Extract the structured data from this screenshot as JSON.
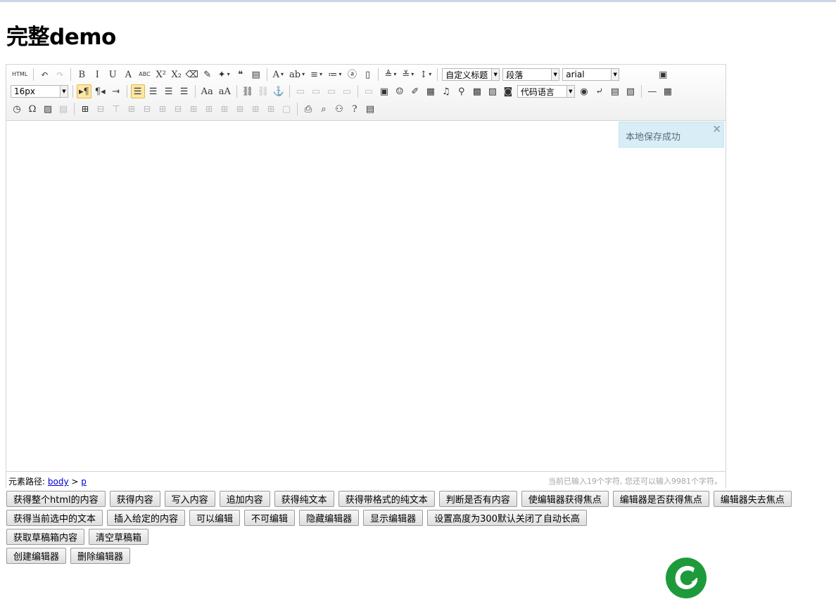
{
  "page": {
    "title": "完整demo"
  },
  "colors": {
    "toast_bg": "#d9edf7",
    "logo_green": "#1e9a3a",
    "footer_count": "#a6a6a6"
  },
  "toolbar": {
    "row1": [
      {
        "name": "source-html-icon",
        "glyph": "HTML",
        "state": "normal",
        "wide": true
      },
      {
        "name": "sep"
      },
      {
        "name": "undo-icon",
        "glyph": "↶",
        "state": "normal"
      },
      {
        "name": "redo-icon",
        "glyph": "↷",
        "state": "disabled"
      },
      {
        "name": "sep"
      },
      {
        "name": "bold-icon",
        "glyph": "B",
        "state": "normal"
      },
      {
        "name": "italic-icon",
        "glyph": "I",
        "state": "normal"
      },
      {
        "name": "underline-icon",
        "glyph": "U",
        "state": "normal"
      },
      {
        "name": "font-border-icon",
        "glyph": "A",
        "state": "normal"
      },
      {
        "name": "strikethrough-icon",
        "glyph": "ABC",
        "state": "normal",
        "wide": true
      },
      {
        "name": "superscript-icon",
        "glyph": "X²",
        "state": "normal"
      },
      {
        "name": "subscript-icon",
        "glyph": "X₂",
        "state": "normal"
      },
      {
        "name": "eraser-icon",
        "glyph": "⌫",
        "state": "normal"
      },
      {
        "name": "format-brush-icon",
        "glyph": "✎",
        "state": "normal"
      },
      {
        "name": "auto-typeset-icon",
        "glyph": "✦",
        "state": "normal",
        "caret": true
      },
      {
        "name": "blockquote-icon",
        "glyph": "❝",
        "state": "normal"
      },
      {
        "name": "paste-plain-icon",
        "glyph": "▤",
        "state": "normal"
      },
      {
        "name": "sep"
      },
      {
        "name": "font-color-icon",
        "glyph": "A",
        "state": "normal",
        "caret": true
      },
      {
        "name": "background-color-icon",
        "glyph": "ab",
        "state": "normal",
        "caret": true
      },
      {
        "name": "ordered-list-icon",
        "glyph": "≡",
        "state": "normal",
        "caret": true
      },
      {
        "name": "unordered-list-icon",
        "glyph": "≔",
        "state": "normal",
        "caret": true
      },
      {
        "name": "select-all-icon",
        "glyph": "ⓐ",
        "state": "normal"
      },
      {
        "name": "clear-doc-icon",
        "glyph": "▯",
        "state": "normal"
      },
      {
        "name": "sep"
      },
      {
        "name": "row-spacing-top-icon",
        "glyph": "≜",
        "state": "normal",
        "caret": true
      },
      {
        "name": "row-spacing-bottom-icon",
        "glyph": "≚",
        "state": "normal",
        "caret": true
      },
      {
        "name": "line-height-icon",
        "glyph": "↕",
        "state": "normal",
        "caret": true
      }
    ],
    "combos": [
      {
        "name": "custom-title-select",
        "value": "自定义标题",
        "width": 82
      },
      {
        "name": "paragraph-select",
        "value": "段落",
        "width": 81
      },
      {
        "name": "font-family-select",
        "value": "arial",
        "width": 81
      }
    ],
    "fullscreen_icon": "▣",
    "fontsize_combo": {
      "name": "font-size-select",
      "value": "16px",
      "width": 82
    },
    "row2": [
      {
        "name": "direction-ltr-icon",
        "glyph": "▸¶",
        "state": "active",
        "wide": true
      },
      {
        "name": "direction-rtl-icon",
        "glyph": "¶◂",
        "state": "normal",
        "wide": true
      },
      {
        "name": "indent-icon",
        "glyph": "⇥",
        "state": "normal"
      },
      {
        "name": "sep"
      },
      {
        "name": "align-left-icon",
        "glyph": "☰",
        "state": "active"
      },
      {
        "name": "align-center-icon",
        "glyph": "☰",
        "state": "normal"
      },
      {
        "name": "align-right-icon",
        "glyph": "☰",
        "state": "normal"
      },
      {
        "name": "align-justify-icon",
        "glyph": "☰",
        "state": "normal"
      },
      {
        "name": "sep"
      },
      {
        "name": "to-uppercase-icon",
        "glyph": "Aa",
        "state": "normal",
        "wide": true
      },
      {
        "name": "to-lowercase-icon",
        "glyph": "aA",
        "state": "normal",
        "wide": true
      },
      {
        "name": "sep"
      },
      {
        "name": "link-icon",
        "glyph": "⛓",
        "state": "normal"
      },
      {
        "name": "unlink-icon",
        "glyph": "⛓",
        "state": "disabled"
      },
      {
        "name": "anchor-icon",
        "glyph": "⚓",
        "state": "normal"
      },
      {
        "name": "sep"
      },
      {
        "name": "image-none-icon",
        "glyph": "▭",
        "state": "disabled"
      },
      {
        "name": "image-left-icon",
        "glyph": "▭",
        "state": "disabled"
      },
      {
        "name": "image-right-icon",
        "glyph": "▭",
        "state": "disabled"
      },
      {
        "name": "image-center-icon",
        "glyph": "▭",
        "state": "disabled"
      },
      {
        "name": "sep"
      },
      {
        "name": "simple-upload-icon",
        "glyph": "▭",
        "state": "disabled"
      },
      {
        "name": "insert-image-icon",
        "glyph": "▣",
        "state": "normal"
      },
      {
        "name": "emotion-icon",
        "glyph": "☺",
        "state": "normal"
      },
      {
        "name": "scrawl-icon",
        "glyph": "✐",
        "state": "normal"
      },
      {
        "name": "insert-video-icon",
        "glyph": "▦",
        "state": "normal"
      },
      {
        "name": "music-icon",
        "glyph": "♫",
        "state": "normal"
      },
      {
        "name": "attachment-icon",
        "glyph": "⚲",
        "state": "normal"
      },
      {
        "name": "map-icon",
        "glyph": "▩",
        "state": "normal"
      },
      {
        "name": "gmap-icon",
        "glyph": "▨",
        "state": "normal"
      },
      {
        "name": "insert-frame-icon",
        "glyph": "◙",
        "state": "normal"
      }
    ],
    "code_combo": {
      "name": "code-language-select",
      "value": "代码语言",
      "width": 82
    },
    "row2b": [
      {
        "name": "webapp-icon",
        "glyph": "◉",
        "state": "normal"
      },
      {
        "name": "pagebreak-icon",
        "glyph": "⤶",
        "state": "normal"
      },
      {
        "name": "template-icon",
        "glyph": "▤",
        "state": "normal"
      },
      {
        "name": "background-icon",
        "glyph": "▧",
        "state": "normal"
      },
      {
        "name": "sep"
      },
      {
        "name": "horizontal-rule-icon",
        "glyph": "—",
        "state": "normal"
      },
      {
        "name": "date-icon",
        "glyph": "▦",
        "state": "normal"
      }
    ],
    "row3": [
      {
        "name": "time-icon",
        "glyph": "◷",
        "state": "normal"
      },
      {
        "name": "special-chars-icon",
        "glyph": "Ω",
        "state": "normal"
      },
      {
        "name": "snap-screen-icon",
        "glyph": "▨",
        "state": "normal"
      },
      {
        "name": "word-image-icon",
        "glyph": "▤",
        "state": "disabled"
      },
      {
        "name": "sep"
      },
      {
        "name": "insert-table-icon",
        "glyph": "⊞",
        "state": "normal"
      },
      {
        "name": "delete-table-icon",
        "glyph": "⊟",
        "state": "disabled"
      },
      {
        "name": "insert-paragraph-before-table-icon",
        "glyph": "⊤",
        "state": "disabled"
      },
      {
        "name": "insert-row-icon",
        "glyph": "⊞",
        "state": "disabled"
      },
      {
        "name": "delete-row-icon",
        "glyph": "⊟",
        "state": "disabled"
      },
      {
        "name": "insert-col-icon",
        "glyph": "⊞",
        "state": "disabled"
      },
      {
        "name": "delete-col-icon",
        "glyph": "⊟",
        "state": "disabled"
      },
      {
        "name": "merge-cells-icon",
        "glyph": "⊞",
        "state": "disabled"
      },
      {
        "name": "merge-right-icon",
        "glyph": "⊞",
        "state": "disabled"
      },
      {
        "name": "merge-down-icon",
        "glyph": "⊞",
        "state": "disabled"
      },
      {
        "name": "split-to-cells-icon",
        "glyph": "⊞",
        "state": "disabled"
      },
      {
        "name": "split-to-rows-icon",
        "glyph": "⊞",
        "state": "disabled"
      },
      {
        "name": "split-to-cols-icon",
        "glyph": "⊞",
        "state": "disabled"
      },
      {
        "name": "charts-icon",
        "glyph": "▢",
        "state": "disabled"
      },
      {
        "name": "sep"
      },
      {
        "name": "print-icon",
        "glyph": "⎙",
        "state": "normal"
      },
      {
        "name": "preview-icon",
        "glyph": "⌕",
        "state": "normal"
      },
      {
        "name": "search-replace-icon",
        "glyph": "⚇",
        "state": "normal"
      },
      {
        "name": "help-icon",
        "glyph": "?",
        "state": "normal"
      },
      {
        "name": "drafts-icon",
        "glyph": "▤",
        "state": "normal"
      }
    ]
  },
  "toast": {
    "message": "本地保存成功",
    "close": "×"
  },
  "footer": {
    "path_label": "元素路径:",
    "path_body": "body",
    "path_sep": ">",
    "path_p": "p",
    "word_count": "当前已输入19个字符, 您还可以输入9981个字符。"
  },
  "buttons": {
    "row1": [
      "获得整个html的内容",
      "获得内容",
      "写入内容",
      "追加内容",
      "获得纯文本",
      "获得带格式的纯文本",
      "判断是否有内容",
      "使编辑器获得焦点",
      "编辑器是否获得焦点",
      "编辑器失去焦点"
    ],
    "row2": [
      "获得当前选中的文本",
      "插入给定的内容",
      "可以编辑",
      "不可编辑",
      "隐藏编辑器",
      "显示编辑器",
      "设置高度为300默认关闭了自动长高"
    ],
    "row3": [
      "获取草稿箱内容",
      "清空草稿箱"
    ],
    "row4": [
      "创建编辑器",
      "删除编辑器"
    ]
  }
}
